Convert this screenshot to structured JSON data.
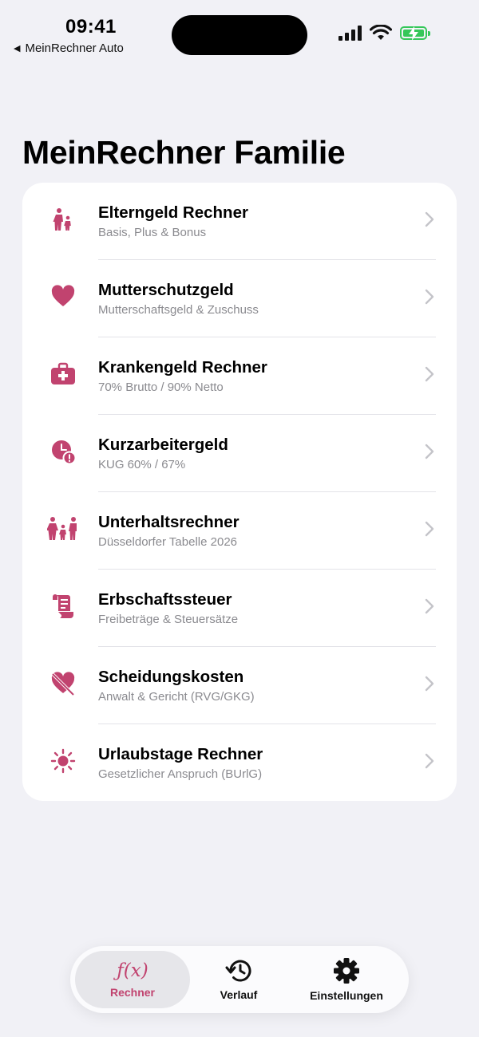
{
  "status_bar": {
    "time": "09:41",
    "back_app": "MeinRechner Auto"
  },
  "page": {
    "title": "MeinRechner Familie"
  },
  "accent": "#c1436f",
  "menu": [
    {
      "icon": "family-walking-icon",
      "title": "Elterngeld Rechner",
      "subtitle": "Basis, Plus & Bonus"
    },
    {
      "icon": "heart-icon",
      "title": "Mutterschutzgeld",
      "subtitle": "Mutterschaftsgeld & Zuschuss"
    },
    {
      "icon": "medical-bag-icon",
      "title": "Krankengeld Rechner",
      "subtitle": "70% Brutto / 90% Netto"
    },
    {
      "icon": "clock-alert-icon",
      "title": "Kurzarbeitergeld",
      "subtitle": "KUG 60% / 67%"
    },
    {
      "icon": "family-icon",
      "title": "Unterhaltsrechner",
      "subtitle": "Düsseldorfer Tabelle 2026"
    },
    {
      "icon": "scroll-icon",
      "title": "Erbschaftssteuer",
      "subtitle": "Freibeträge & Steuersätze"
    },
    {
      "icon": "heart-slash-icon",
      "title": "Scheidungskosten",
      "subtitle": "Anwalt & Gericht (RVG/GKG)"
    },
    {
      "icon": "sun-icon",
      "title": "Urlaubstage Rechner",
      "subtitle": "Gesetzlicher Anspruch (BUrlG)"
    }
  ],
  "tabbar": {
    "rechner": {
      "glyph": "ƒ(x)",
      "label": "Rechner",
      "selected": true
    },
    "verlauf": {
      "label": "Verlauf"
    },
    "einstellungen": {
      "label": "Einstellungen"
    }
  }
}
